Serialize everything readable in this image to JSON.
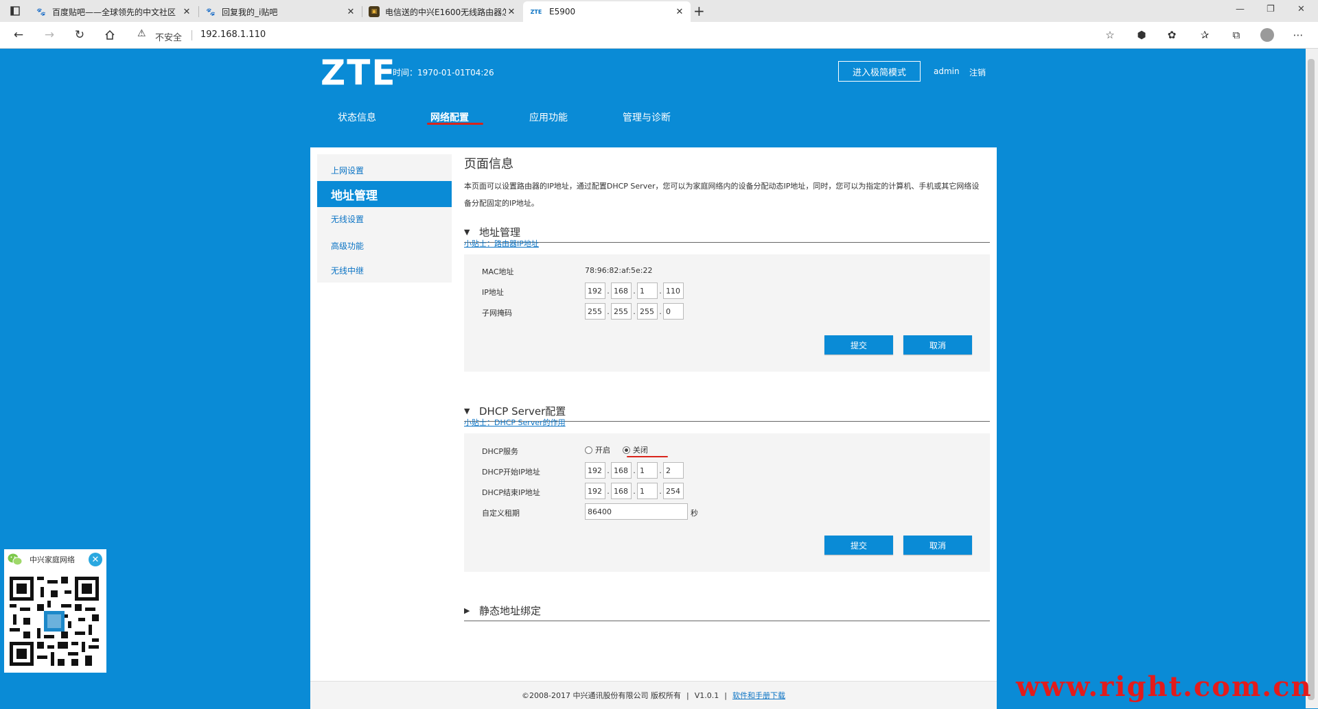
{
  "browser": {
    "tabs": [
      {
        "title": "百度贴吧——全球领先的中文社区",
        "favicon": "baidu-paw-icon"
      },
      {
        "title": "回复我的_i贴吧",
        "favicon": "baidu-paw-icon"
      },
      {
        "title": "电信送的中兴E1600无线路由器怎...",
        "favicon": "site-icon"
      },
      {
        "title": "E5900",
        "favicon_text": "ZTE",
        "active": true
      }
    ],
    "security_label": "不安全",
    "url": "192.168.1.110"
  },
  "header": {
    "logo": "ZTE",
    "time": "时间：1970-01-01T04:26",
    "simple_mode_button": "进入极简模式",
    "user": "admin",
    "logout": "注销"
  },
  "main_nav": [
    {
      "label": "状态信息"
    },
    {
      "label": "网络配置",
      "active": true
    },
    {
      "label": "应用功能"
    },
    {
      "label": "管理与诊断"
    }
  ],
  "sidebar": {
    "items": [
      {
        "label": "上网设置"
      },
      {
        "label": "地址管理",
        "active": true
      },
      {
        "label": "无线设置"
      },
      {
        "label": "高级功能"
      },
      {
        "label": "无线中继"
      }
    ]
  },
  "page_info": {
    "title": "页面信息",
    "description": "本页面可以设置路由器的IP地址，通过配置DHCP Server，您可以为家庭网络内的设备分配动态IP地址，同时，您可以为指定的计算机、手机或其它网络设备分配固定的IP地址。"
  },
  "address_section": {
    "title": "地址管理",
    "tip": "小贴士：路由器IP地址",
    "mac_label": "MAC地址",
    "mac_value": "78:96:82:af:5e:22",
    "ip_label": "IP地址",
    "ip": [
      "192",
      "168",
      "1",
      "110"
    ],
    "mask_label": "子网掩码",
    "mask": [
      "255",
      "255",
      "255",
      "0"
    ],
    "submit": "提交",
    "cancel": "取消"
  },
  "dhcp_section": {
    "title": "DHCP Server配置",
    "tip": "小贴士：DHCP Server的作用",
    "service_label": "DHCP服务",
    "option_on": "开启",
    "option_off": "关闭",
    "selected": "关闭",
    "start_label": "DHCP开始IP地址",
    "start_ip": [
      "192",
      "168",
      "1",
      "2"
    ],
    "end_label": "DHCP结束IP地址",
    "end_ip": [
      "192",
      "168",
      "1",
      "254"
    ],
    "lease_label": "自定义租期",
    "lease_value": "86400",
    "lease_unit": "秒",
    "submit": "提交",
    "cancel": "取消"
  },
  "static_section": {
    "title": "静态地址绑定"
  },
  "footer": {
    "copyright": "©2008-2017 中兴通讯股份有限公司 版权所有",
    "separator": "|",
    "version": "V1.0.1",
    "download_link": "软件和手册下载"
  },
  "qr_widget": {
    "title": "中兴家庭网络"
  },
  "watermark": "www.right.com.cn",
  "colors": {
    "page_bg": "#0a8bd6",
    "accent": "#0a8bd6",
    "link": "#0a73c4",
    "annotation_red": "#d9241b"
  }
}
